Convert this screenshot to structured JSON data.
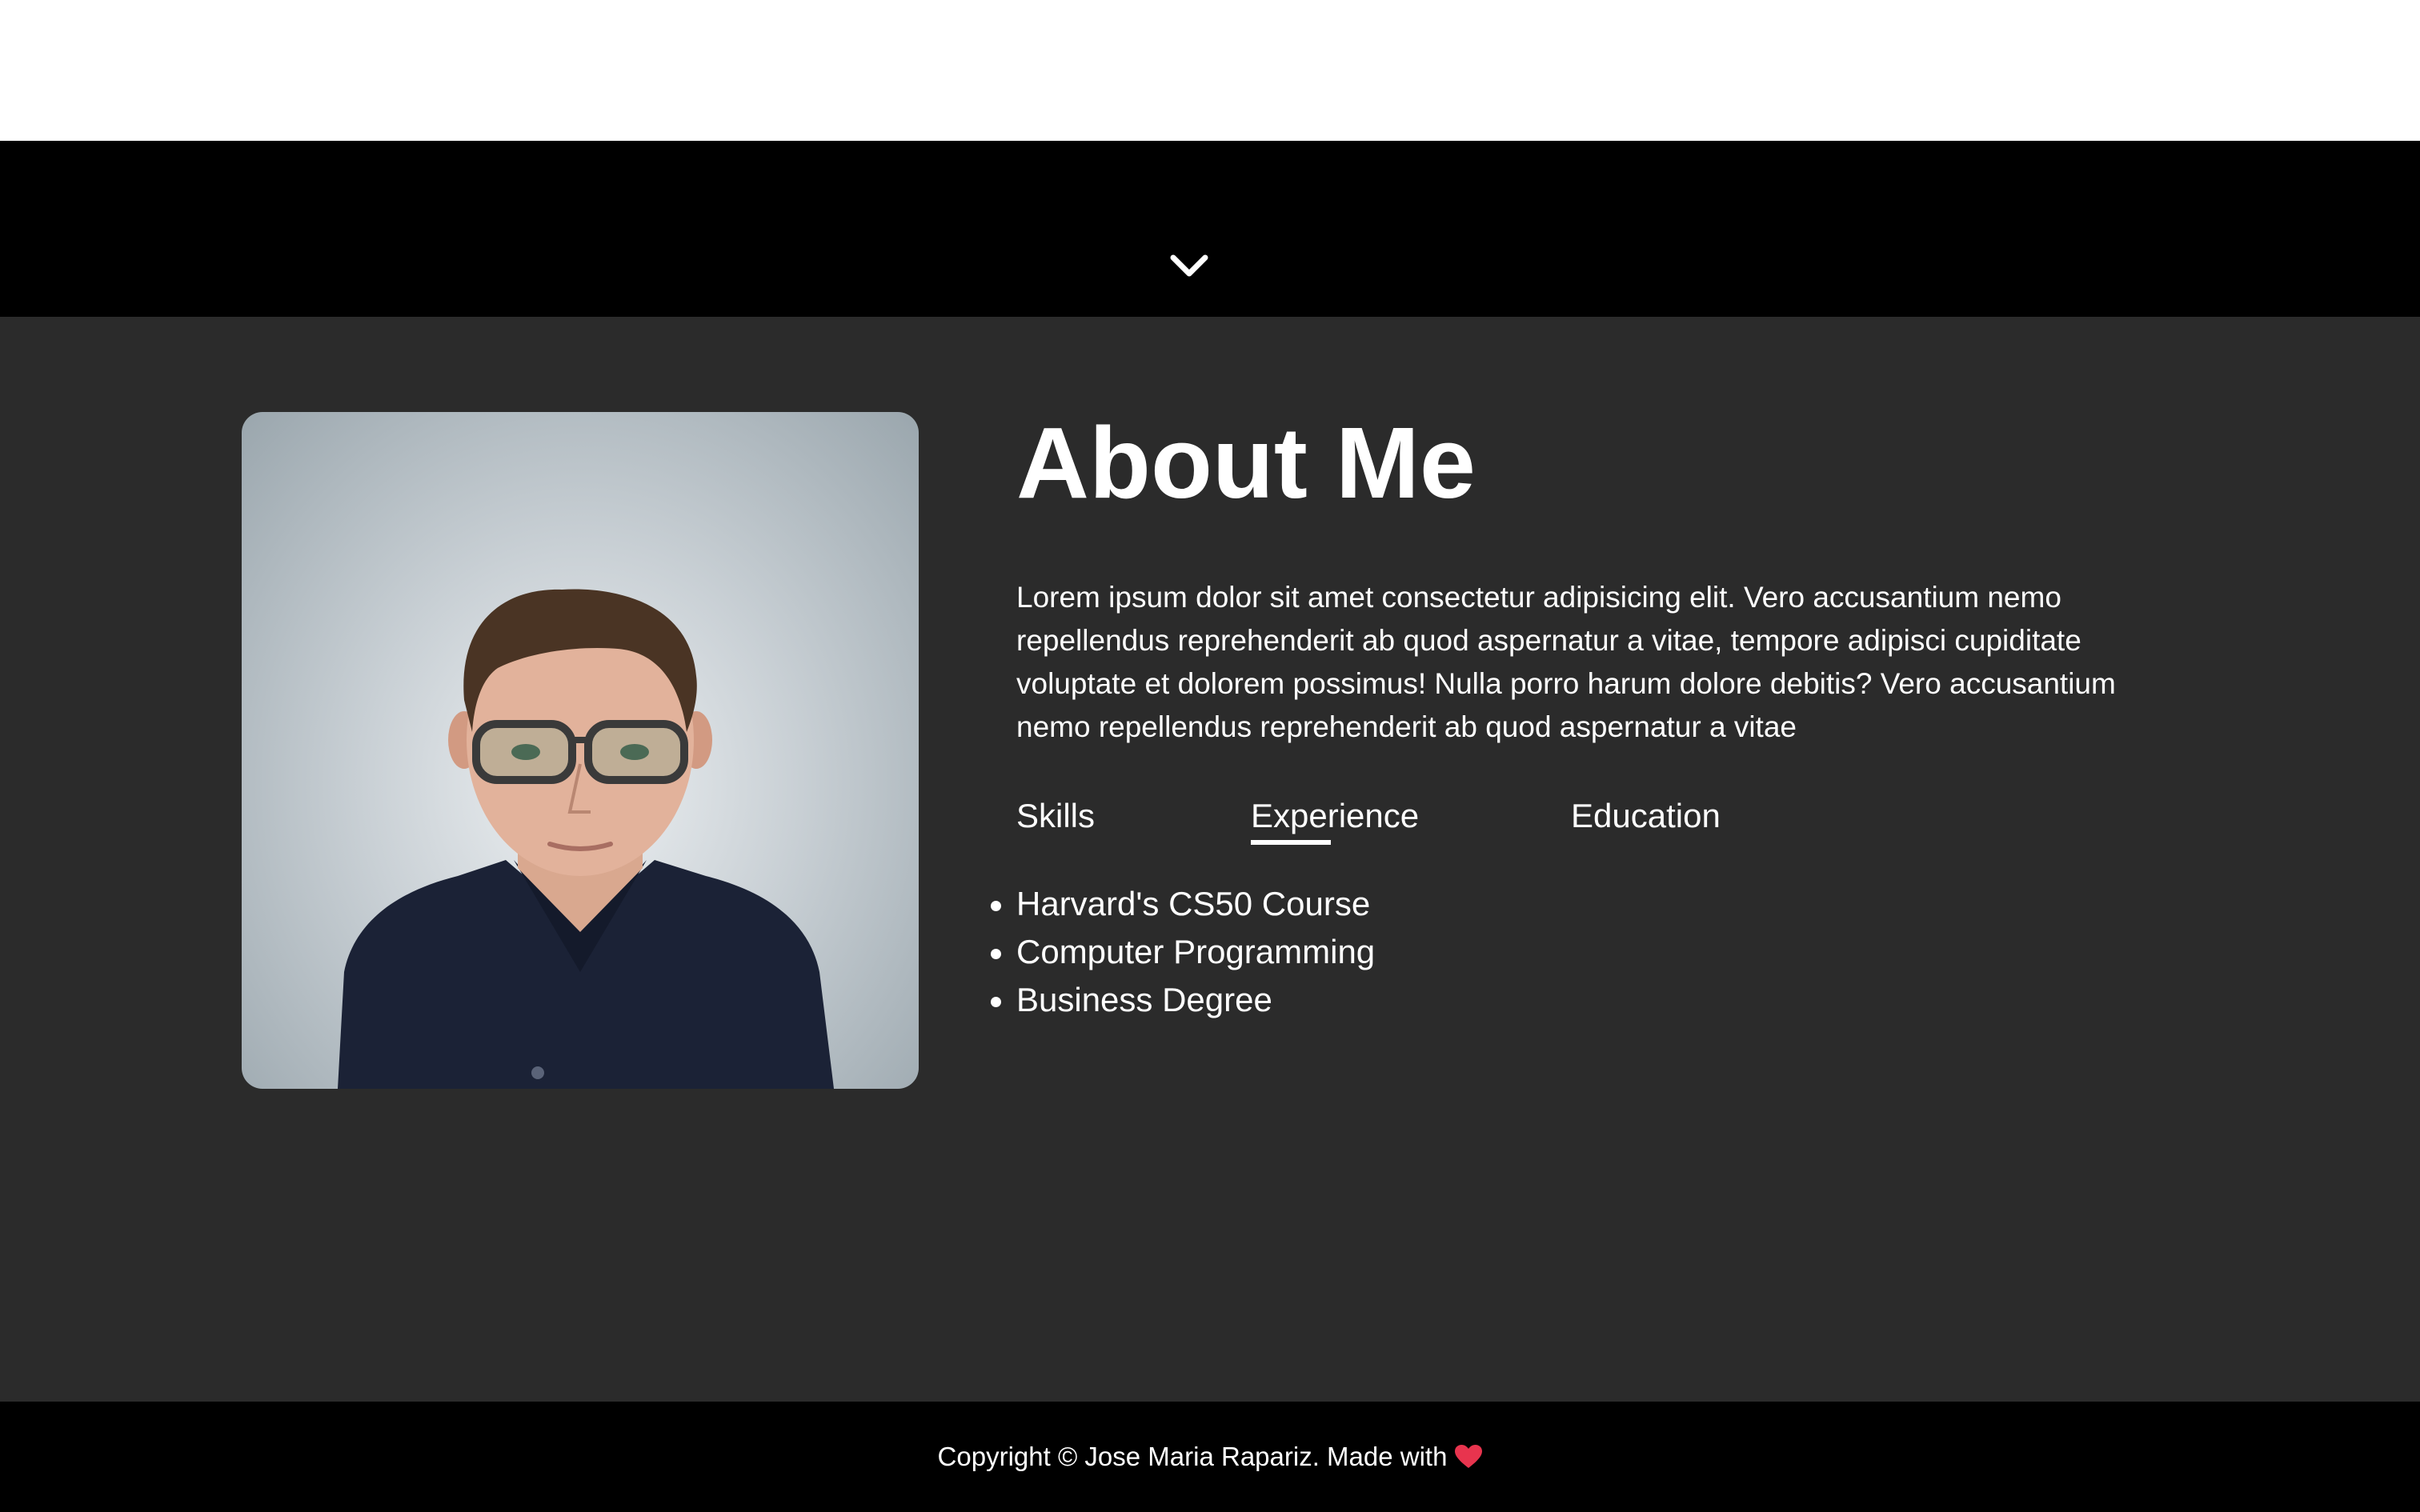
{
  "hero": {
    "scroll_icon": "chevron-down-icon"
  },
  "about": {
    "title": "About Me",
    "paragraph": "Lorem ipsum dolor sit amet consectetur adipisicing elit. Vero accusantium nemo repellendus reprehenderit ab quod aspernatur a vitae, tempore adipisci cupiditate voluptate et dolorem possimus! Nulla porro harum dolore debitis? Vero accusantium nemo repellendus reprehenderit ab quod aspernatur a vitae",
    "tabs": [
      {
        "label": "Skills",
        "active": false
      },
      {
        "label": "Experience",
        "active": true
      },
      {
        "label": "Education",
        "active": false
      }
    ],
    "items": [
      "Harvard's CS50 Course",
      "Computer Programming",
      "Business Degree"
    ],
    "photo_icon": "profile-photo"
  },
  "footer": {
    "text": "Copyright © Jose Maria Rapariz. Made with",
    "heart_icon": "heart-icon",
    "heart_color": "#e8344e"
  },
  "colors": {
    "page_bg": "#2b2b2b",
    "band_bg": "#000000",
    "top_bg": "#ffffff",
    "text": "#ffffff"
  }
}
